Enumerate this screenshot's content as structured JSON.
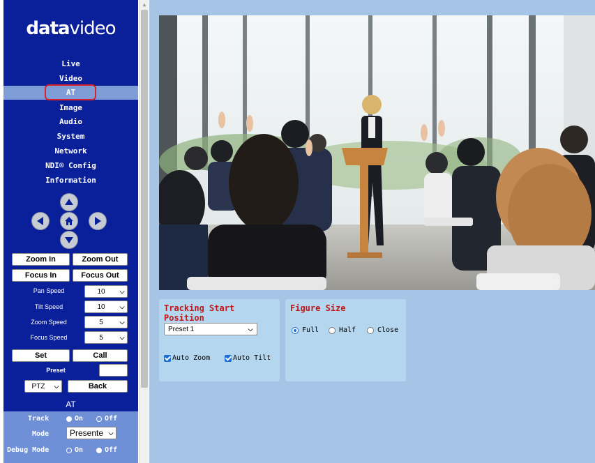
{
  "logo": {
    "bold": "data",
    "light": "video"
  },
  "nav": {
    "items": [
      "Live",
      "Video",
      "AT",
      "Image",
      "Audio",
      "System",
      "Network",
      "NDI® Config",
      "Information"
    ],
    "active": "AT"
  },
  "controls": {
    "zoom_in": "Zoom In",
    "zoom_out": "Zoom Out",
    "focus_in": "Focus In",
    "focus_out": "Focus Out",
    "pan_speed_label": "Pan Speed",
    "pan_speed_value": "10",
    "tilt_speed_label": "Tilt Speed",
    "tilt_speed_value": "10",
    "zoom_speed_label": "Zoom Speed",
    "zoom_speed_value": "5",
    "focus_speed_label": "Focus Speed",
    "focus_speed_value": "5",
    "set": "Set",
    "call": "Call",
    "preset_label": "Preset",
    "preset_value": "",
    "mode_select": "PTZ",
    "back": "Back"
  },
  "at": {
    "title": "AT",
    "track_label": "Track",
    "track_on": "On",
    "track_off": "Off",
    "track_selected": "On",
    "mode_label": "Mode",
    "mode_value": "Presente",
    "debug_label": "Debug Mode",
    "debug_on": "On",
    "debug_off": "Off",
    "debug_selected": "Off"
  },
  "tracking": {
    "title": "Tracking Start Position",
    "preset": "Preset 1",
    "auto_zoom": "Auto Zoom",
    "auto_zoom_checked": true,
    "auto_tilt": "Auto Tilt",
    "auto_tilt_checked": true
  },
  "figure": {
    "title": "Figure Size",
    "options": [
      "Full",
      "Half",
      "Close"
    ],
    "selected": "Full"
  },
  "colors": {
    "sidebar": "#0a1f9a",
    "active_nav": "#7f9dd6",
    "highlight": "#d8232a",
    "main_bg": "#a6c4e6",
    "panel_bg": "#b4d6ef",
    "title_red": "#c01818"
  }
}
